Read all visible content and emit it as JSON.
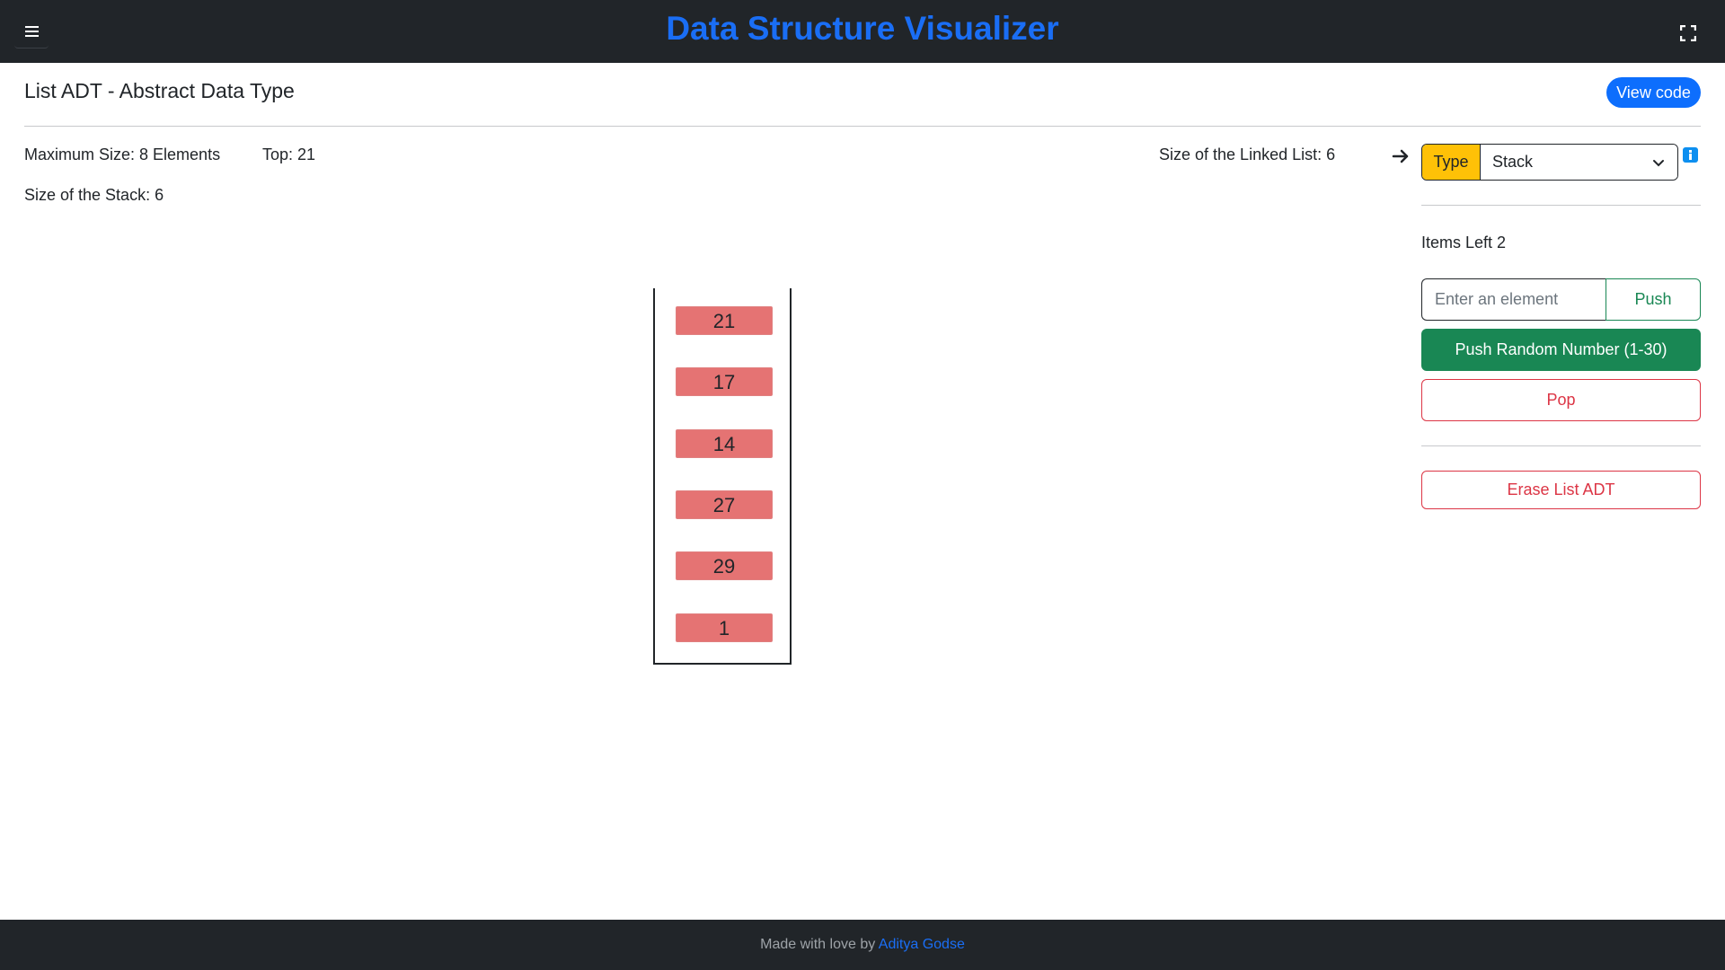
{
  "navbar": {
    "title": "Data Structure Visualizer",
    "menu_icon": "hamburger-icon",
    "fullscreen_icon": "fullscreen-icon",
    "title_color": "#1a6ef5",
    "background": "#212529"
  },
  "header": {
    "title": "List ADT - Abstract Data Type",
    "view_code_label": "View code"
  },
  "info": {
    "max_size": "Maximum Size: 8 Elements",
    "top": "Top: 21",
    "linked_list_size": "Size of the Linked List: 6",
    "stack_size": "Size of the Stack: 6"
  },
  "stack": {
    "items": [
      "21",
      "17",
      "14",
      "27",
      "29",
      "1"
    ],
    "item_color": "#e57373"
  },
  "panel": {
    "arrow_icon": "arrow-right-icon",
    "type_label": "Type",
    "type_value": "Stack",
    "info_icon": "info-icon",
    "items_left": "Items Left 2",
    "input_placeholder": "Enter an element",
    "push_label": "Push",
    "push_random_label": "Push Random Number (1-30)",
    "pop_label": "Pop",
    "erase_label": "Erase List ADT"
  },
  "footer": {
    "text": "Made with love by ",
    "author": "Aditya Godse"
  }
}
